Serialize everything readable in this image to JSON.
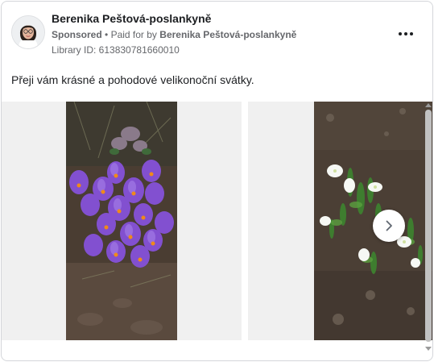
{
  "advertiser": {
    "name": "Berenika Peštová-poslankyně",
    "sponsored_label": "Sponsored",
    "separator": "•",
    "paid_for_prefix": "Paid for by",
    "paid_for_name": "Berenika Peštová-poslankyně",
    "library_id": "Library ID: 613830781660010"
  },
  "post": {
    "message": "Přeji vám krásné a pohodové velikonoční svátky."
  },
  "carousel": {
    "slides": [
      {
        "subject": "purple crocus flowers"
      },
      {
        "subject": "white snowdrop flowers"
      }
    ]
  },
  "icons": {
    "more": "more-options-icon",
    "next": "chevron-right-icon"
  },
  "colors": {
    "text_primary": "#1c1e21",
    "text_secondary": "#65676b",
    "border": "#d4d6da"
  }
}
